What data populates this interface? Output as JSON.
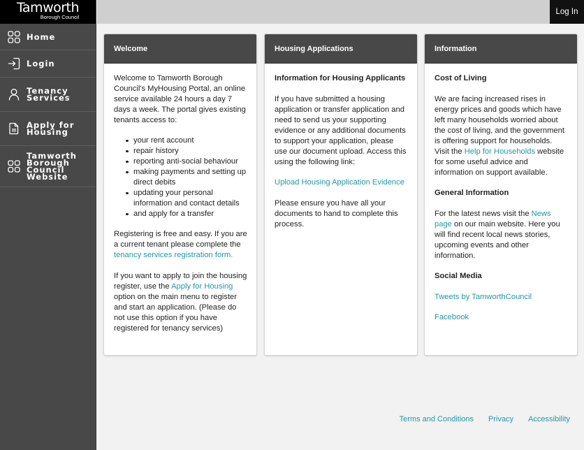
{
  "brand": {
    "name": "Tamworth",
    "subtitle": "Borough Council"
  },
  "sidebar": {
    "items": [
      {
        "label": "Home",
        "icon": "grid-icon"
      },
      {
        "label": "Login",
        "icon": "login-arrow-icon"
      },
      {
        "label": "Tenancy Services",
        "icon": "user-icon"
      },
      {
        "label": "Apply for Housing",
        "icon": "document-icon"
      },
      {
        "label": "Tamworth Borough Council Website",
        "icon": "grid-icon"
      }
    ]
  },
  "topbar": {
    "login_label": "Log In"
  },
  "cards": {
    "welcome": {
      "title": "Welcome",
      "intro": "Welcome to Tamworth Borough Council's MyHousing Portal, an online service available 24 hours a day 7 days a week. The portal gives existing tenants access to:",
      "list": [
        "your rent account",
        "repair history",
        "reporting anti-social behaviour",
        "making payments and setting up direct debits",
        "updating your personal information and contact details",
        "and apply for a transfer"
      ],
      "register_pre": "Registering is free and easy. If you are a current tenant please complete the ",
      "register_link": "tenancy services registration form.",
      "apply_pre": "If you want to apply to join the housing register, use the ",
      "apply_link": "Apply for Housing",
      "apply_post": " option on the main menu to register and start an application. (Please do not use this option if you have registered for tenancy services)"
    },
    "housing": {
      "title": "Housing Applications",
      "subtitle": "Information for Housing Applicants",
      "body": "If you have submitted a housing application or transfer application and need to send us your supporting evidence or any additional documents to support your application, please use our document upload. Access this using the following link:",
      "link": "Upload Housing Application Evidence",
      "closing": "Please ensure you have all your documents to hand to complete this process."
    },
    "info": {
      "title": "Information",
      "col_heading": "Cost of Living",
      "col_pre": "We are facing increased rises in energy prices and goods which have left many households worried about the cost of living, and the government is offering support for households. Visit the ",
      "col_link": "Help for Households",
      "col_post": " website for some useful advice and information on support available.",
      "gen_heading": "General Information",
      "gen_pre": "For the latest news visit the ",
      "gen_link": "News page",
      "gen_post": " on our main website. Here you will find recent local news stories, upcoming events and other information.",
      "social_heading": "Social Media",
      "twitter_link": "Tweets by TamworthCouncil",
      "facebook_link": "Facebook"
    }
  },
  "footer": {
    "links": [
      "Terms and Conditions",
      "Privacy",
      "Accessibility"
    ]
  },
  "colors": {
    "accent": "#1f98a8",
    "sidebar": "#484848",
    "header": "#000000"
  }
}
